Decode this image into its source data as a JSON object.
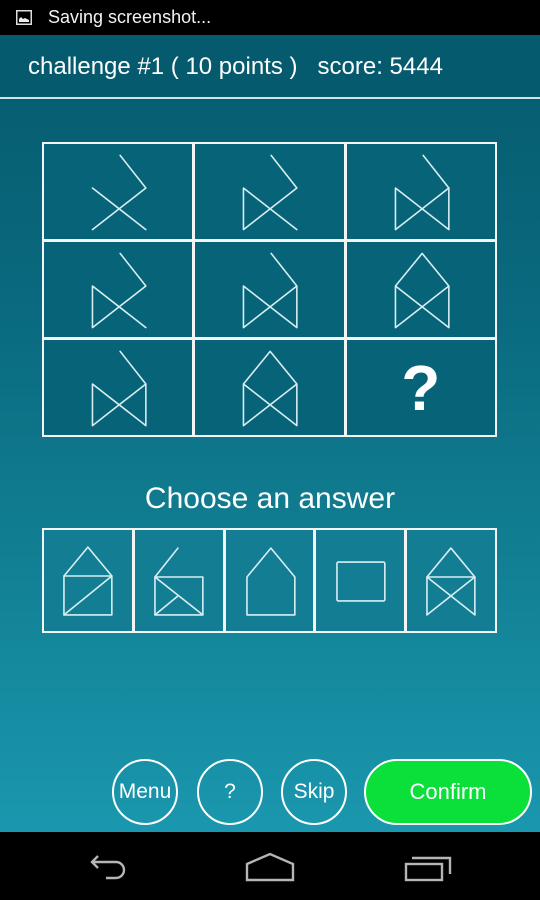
{
  "status_bar": {
    "icon": "image-icon",
    "text": "Saving screenshot..."
  },
  "header": {
    "title": "challenge #1 ( 10 points )   score: 5444",
    "challenge_number": 1,
    "points": 10,
    "score": 5444
  },
  "puzzle": {
    "cells": [
      {
        "figure": "x-with-hook"
      },
      {
        "figure": "x-hook-left-bar"
      },
      {
        "figure": "bowtie-hook"
      },
      {
        "figure": "x-hook-left-bar"
      },
      {
        "figure": "bowtie-hook"
      },
      {
        "figure": "bowtie-roof"
      },
      {
        "figure": "bowtie-hook"
      },
      {
        "figure": "bowtie-roof"
      },
      {
        "figure": "unknown",
        "label": "?"
      }
    ]
  },
  "choose_label": "Choose an answer",
  "answers": [
    {
      "figure": "house-diagonal"
    },
    {
      "figure": "box-slash-hook"
    },
    {
      "figure": "house-outline"
    },
    {
      "figure": "rectangle"
    },
    {
      "figure": "house-cross"
    }
  ],
  "buttons": {
    "menu": "Menu",
    "help": "?",
    "skip": "Skip",
    "confirm": "Confirm"
  },
  "colors": {
    "header_bg": "#055a6d",
    "confirm_bg": "#0be03a",
    "line": "#d8eef2"
  },
  "nav_bar": {
    "back": "back-icon",
    "home": "home-icon",
    "recents": "recents-icon"
  }
}
